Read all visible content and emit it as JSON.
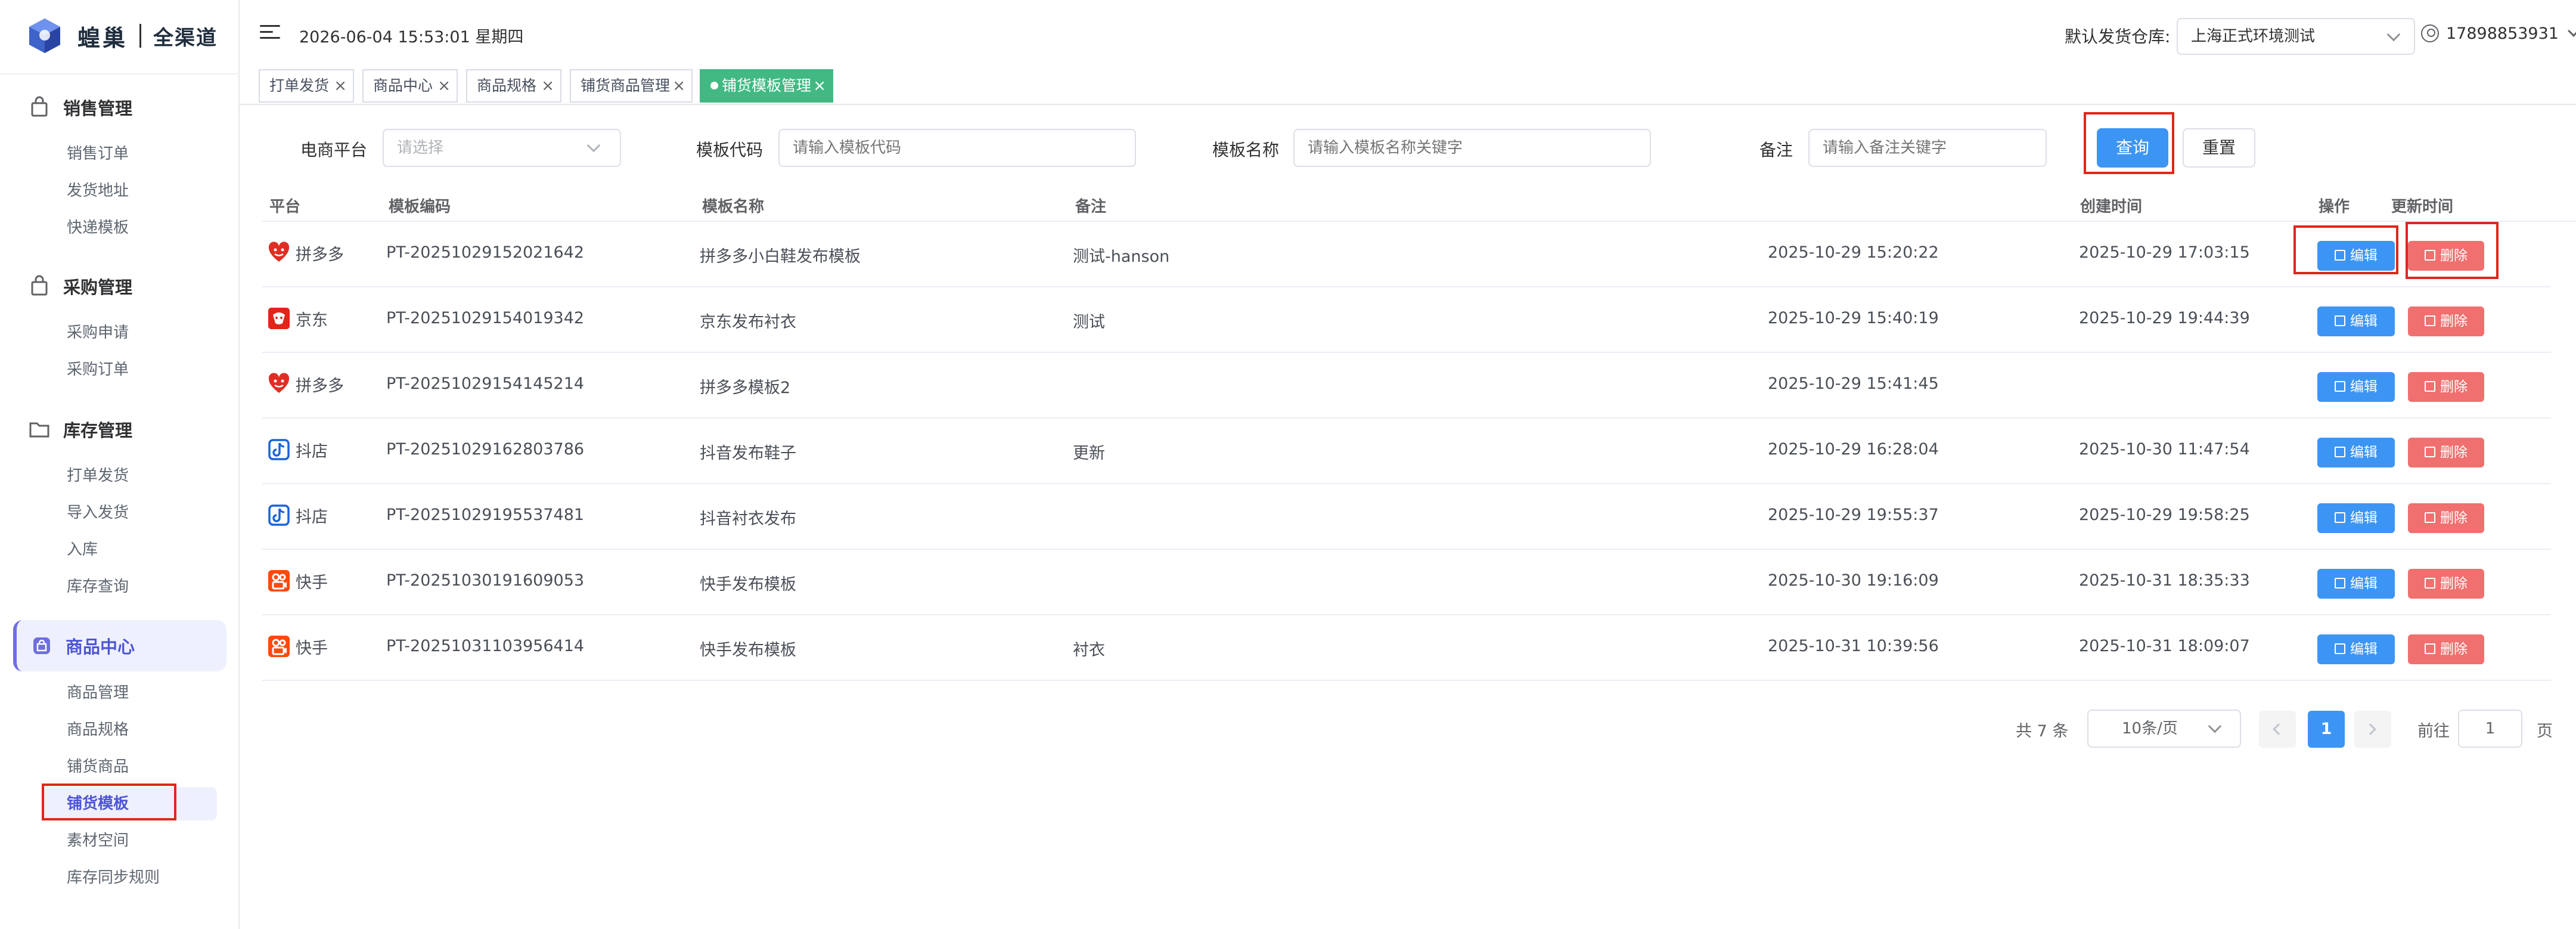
{
  "app": {
    "logo_name": "蝗巢",
    "logo_sub": "全渠道"
  },
  "header": {
    "datetime": "2026-06-04 15:53:01 星期四",
    "warehouse_label": "默认发货仓库:",
    "warehouse_value": "上海正式环境测试",
    "user": "17898853931"
  },
  "sidebar": {
    "groups": [
      {
        "label": "销售管理",
        "items": [
          "销售订单",
          "发货地址",
          "快递模板"
        ]
      },
      {
        "label": "采购管理",
        "items": [
          "采购申请",
          "采购订单"
        ]
      },
      {
        "label": "库存管理",
        "items": [
          "打单发货",
          "导入发货",
          "入库",
          "库存查询"
        ]
      },
      {
        "label": "商品中心",
        "items": [
          "商品管理",
          "商品规格",
          "铺货商品",
          "铺货模板",
          "素材空间",
          "库存同步规则"
        ]
      }
    ]
  },
  "tabs": [
    {
      "label": "打单发货"
    },
    {
      "label": "商品中心"
    },
    {
      "label": "商品规格"
    },
    {
      "label": "铺货商品管理"
    },
    {
      "label": "铺货模板管理"
    }
  ],
  "filters": {
    "platform_label": "电商平台",
    "platform_placeholder": "请选择",
    "code_label": "模板代码",
    "code_placeholder": "请输入模板代码",
    "name_label": "模板名称",
    "name_placeholder": "请输入模板名称关键字",
    "remark_label": "备注",
    "remark_placeholder": "请输入备注关键字",
    "query_label": "查询",
    "reset_label": "重置"
  },
  "table": {
    "columns": [
      "平台",
      "模板编码",
      "模板名称",
      "备注",
      "创建时间",
      "更新时间",
      "操作"
    ],
    "edit_label": "编辑",
    "delete_label": "删除",
    "rows": [
      {
        "platform": "拼多多",
        "icon": "pinduoduo-icon",
        "code": "PT-20251029152021642",
        "name": "拼多多小白鞋发布模板",
        "remark": "测试-hanson",
        "created": "2025-10-29 15:20:22",
        "updated": "2025-10-29 17:03:15"
      },
      {
        "platform": "京东",
        "icon": "jd-icon",
        "code": "PT-20251029154019342",
        "name": "京东发布衬衣",
        "remark": "测试",
        "created": "2025-10-29 15:40:19",
        "updated": "2025-10-29 19:44:39"
      },
      {
        "platform": "拼多多",
        "icon": "pinduoduo-icon",
        "code": "PT-20251029154145214",
        "name": "拼多多模板2",
        "remark": "",
        "created": "2025-10-29 15:41:45",
        "updated": ""
      },
      {
        "platform": "抖店",
        "icon": "douyin-icon",
        "code": "PT-20251029162803786",
        "name": "抖音发布鞋子",
        "remark": "更新",
        "created": "2025-10-29 16:28:04",
        "updated": "2025-10-30 11:47:54"
      },
      {
        "platform": "抖店",
        "icon": "douyin-icon",
        "code": "PT-20251029195537481",
        "name": "抖音衬衣发布",
        "remark": "",
        "created": "2025-10-29 19:55:37",
        "updated": "2025-10-29 19:58:25"
      },
      {
        "platform": "快手",
        "icon": "kuaishou-icon",
        "code": "PT-20251030191609053",
        "name": "快手发布模板",
        "remark": "",
        "created": "2025-10-30 19:16:09",
        "updated": "2025-10-31 18:35:33"
      },
      {
        "platform": "快手",
        "icon": "kuaishou-icon",
        "code": "PT-20251031103956414",
        "name": "快手发布模板",
        "remark": "衬衣",
        "created": "2025-10-31 10:39:56",
        "updated": "2025-10-31 18:09:07"
      }
    ]
  },
  "pagination": {
    "total": "共 7 条",
    "page_size": "10条/页",
    "current_page": "1",
    "goto_label": "前往",
    "goto_value": "1",
    "page_suffix": "页"
  },
  "colors": {
    "primary": "#3d95f3",
    "danger": "#f07070",
    "active_tab": "#42b983",
    "menu_active": "#4e55d6",
    "highlight": "#e0261c"
  }
}
